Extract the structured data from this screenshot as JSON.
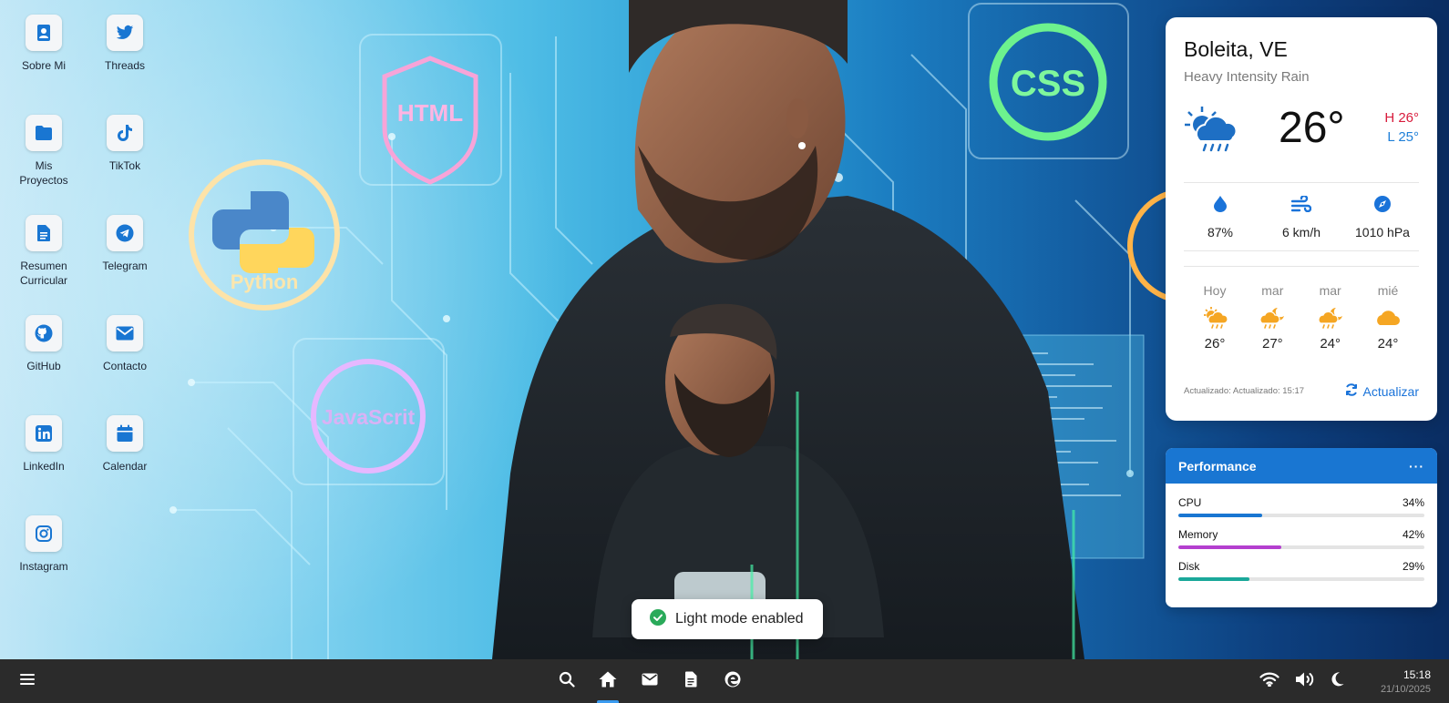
{
  "desktop": {
    "icons": [
      {
        "label": "Sobre Mi",
        "icon": "person-badge-icon"
      },
      {
        "label": "Threads",
        "icon": "twitter-bird-icon"
      },
      {
        "label": "Mis Proyectos",
        "icon": "folder-icon"
      },
      {
        "label": "TikTok",
        "icon": "tiktok-icon"
      },
      {
        "label": "Resumen Curricular",
        "icon": "document-icon"
      },
      {
        "label": "Telegram",
        "icon": "telegram-icon"
      },
      {
        "label": "GitHub",
        "icon": "github-icon"
      },
      {
        "label": "Contacto",
        "icon": "envelope-icon"
      },
      {
        "label": "LinkedIn",
        "icon": "linkedin-icon"
      },
      {
        "label": "Calendar",
        "icon": "calendar-icon"
      },
      {
        "label": "Instagram",
        "icon": "instagram-icon"
      }
    ]
  },
  "wallpaper": {
    "badges": {
      "html": "HTML",
      "css": "CSS",
      "python": "Python",
      "javascript": "JavaScrit"
    }
  },
  "weather": {
    "city": "Boleita, VE",
    "description": "Heavy Intensity Rain",
    "temperature": "26°",
    "high": "H 26°",
    "low": "L 25°",
    "humidity": "87%",
    "wind": "6 km/h",
    "pressure": "1010 hPa",
    "forecast": [
      {
        "day": "Hoy",
        "temp": "26°",
        "icon": "sun-cloud-rain-icon"
      },
      {
        "day": "mar",
        "temp": "27°",
        "icon": "moon-cloud-rain-icon"
      },
      {
        "day": "mar",
        "temp": "24°",
        "icon": "moon-cloud-rain-icon"
      },
      {
        "day": "mié",
        "temp": "24°",
        "icon": "cloud-icon"
      }
    ],
    "updated": "Actualizado: Actualizado: 15:17",
    "refresh_label": "Actualizar",
    "colors": {
      "high": "#d81b3c",
      "low": "#1e7fd8",
      "accent": "#1a73d9",
      "forecast_icon": "#f5a623"
    }
  },
  "performance": {
    "title": "Performance",
    "menu": "···",
    "metrics": [
      {
        "label": "CPU",
        "value": "34%",
        "fraction": 0.34,
        "color": "#1976d2"
      },
      {
        "label": "Memory",
        "value": "42%",
        "fraction": 0.42,
        "color": "#b43fcf"
      },
      {
        "label": "Disk",
        "value": "29%",
        "fraction": 0.29,
        "color": "#1aa89a"
      }
    ]
  },
  "toast": {
    "message": "Light mode enabled",
    "icon": "check-circle-icon",
    "color": "#2aaa5a"
  },
  "taskbar": {
    "apps": [
      "search-icon",
      "home-icon",
      "mail-icon",
      "document-icon",
      "edge-browser-icon"
    ],
    "active_app": "home-icon",
    "tray": [
      "wifi-icon",
      "volume-icon",
      "moon-icon"
    ],
    "time": "15:18",
    "date": "21/10/2025"
  }
}
